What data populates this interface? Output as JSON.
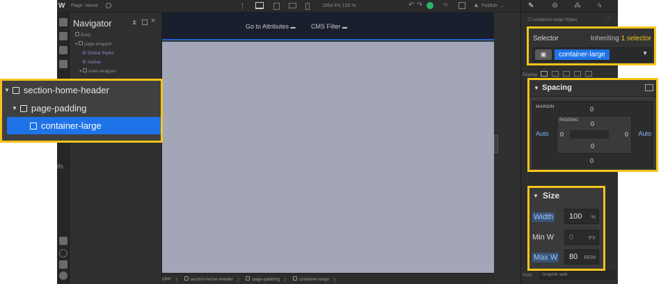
{
  "topbar": {
    "page_label": "Page: Home",
    "viewport": "1064 PX  100 %",
    "publish": "Publish"
  },
  "navigator": {
    "title": "Navigator",
    "tree_small": [
      "Body",
      "page-wrapper",
      "Global Styles",
      "navbar",
      "main-wrapper"
    ],
    "tree_large": [
      {
        "label": "section-home-header",
        "caret": "▼"
      },
      {
        "label": "page-padding",
        "caret": "▼"
      },
      {
        "label": "container-large",
        "caret": ""
      }
    ]
  },
  "leftbar": {
    "fragment": "ifs"
  },
  "canvas": {
    "nav_links": [
      "Go to Attributes",
      "CMS Filter"
    ]
  },
  "breadcrumb": [
    "pper",
    "section-home-header",
    "page-padding",
    "container-large"
  ],
  "inspector": {
    "element_name": "container-large Styles",
    "display_label": "Display",
    "font_label": "Font",
    "font_value": "Graphik web",
    "selector": {
      "label": "Selector",
      "inheriting_prefix": "Inheriting",
      "inheriting_count": "1 selector",
      "chip": "container-large"
    },
    "spacing": {
      "title": "Spacing",
      "margin_label": "MARGIN",
      "padding_label": "PADDING",
      "margin_top": "0",
      "margin_bottom": "0",
      "margin_left": "Auto",
      "margin_right": "Auto",
      "padding_top": "0",
      "padding_bottom": "0",
      "padding_left": "0",
      "padding_right": "0"
    },
    "size": {
      "title": "Size",
      "rows": [
        {
          "label": "Width",
          "value": "100",
          "unit": "%",
          "highlight": true
        },
        {
          "label": "Min W",
          "value": "0",
          "unit": "PX",
          "highlight": false
        },
        {
          "label": "Max W",
          "value": "80",
          "unit": "REM",
          "highlight": true
        }
      ]
    }
  },
  "colors": {
    "highlight": "#f5c51b",
    "selection": "#1e73e8",
    "accent_link": "#f5c51b"
  }
}
